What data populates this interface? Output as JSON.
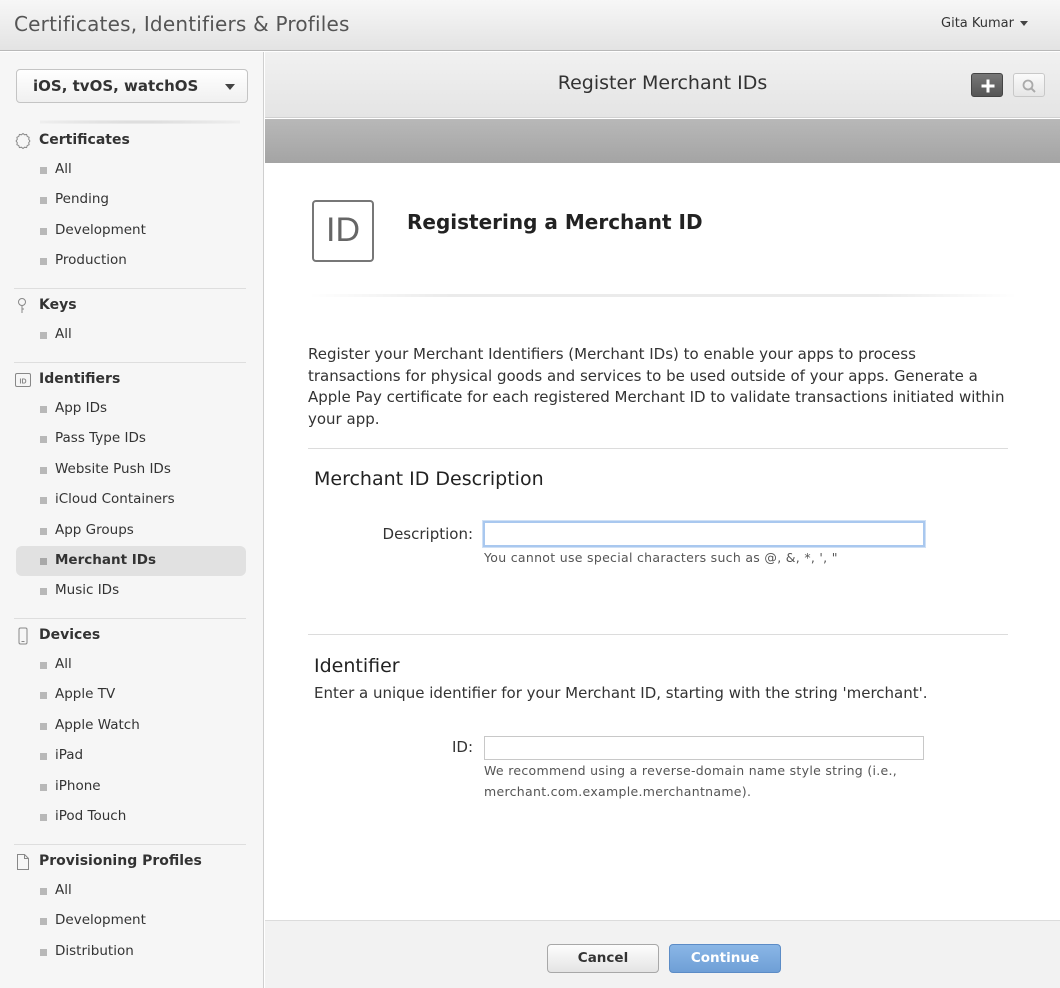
{
  "app_title": "Certificates, Identifiers & Profiles",
  "user": {
    "name": "Gita Kumar"
  },
  "sidebar": {
    "platform": "iOS, tvOS, watchOS",
    "sections": [
      {
        "title": "Certificates",
        "icon": "certificate-icon",
        "items": [
          "All",
          "Pending",
          "Development",
          "Production"
        ]
      },
      {
        "title": "Keys",
        "icon": "key-icon",
        "items": [
          "All"
        ]
      },
      {
        "title": "Identifiers",
        "icon": "id-icon",
        "items": [
          "App IDs",
          "Pass Type IDs",
          "Website Push IDs",
          "iCloud Containers",
          "App Groups",
          "Merchant IDs",
          "Music IDs"
        ]
      },
      {
        "title": "Devices",
        "icon": "device-icon",
        "items": [
          "All",
          "Apple TV",
          "Apple Watch",
          "iPad",
          "iPhone",
          "iPod Touch"
        ]
      },
      {
        "title": "Provisioning Profiles",
        "icon": "document-icon",
        "items": [
          "All",
          "Development",
          "Distribution"
        ]
      }
    ],
    "active_item": "Merchant IDs"
  },
  "header": {
    "title": "Register Merchant IDs"
  },
  "content": {
    "badge_text": "ID",
    "title": "Registering a Merchant ID",
    "intro": "Register your Merchant Identifiers (Merchant IDs) to enable your apps to process transactions for physical goods and services to be used outside of your apps. Generate a Apple Pay certificate for each registered Merchant ID to validate transactions initiated within your app.",
    "description_section": {
      "title": "Merchant ID Description",
      "label": "Description:",
      "value": "",
      "hint": "You cannot use special characters such as @, &, *, ', \""
    },
    "identifier_section": {
      "title": "Identifier",
      "subtitle": "Enter a unique identifier for your Merchant ID, starting with the string 'merchant'.",
      "label": "ID:",
      "value": "",
      "hint_line1": "We recommend using a reverse-domain name style string (i.e.,",
      "hint_line2": "merchant.com.example.merchantname)."
    }
  },
  "footer": {
    "cancel_label": "Cancel",
    "continue_label": "Continue"
  },
  "colors": {
    "accent": "#6f9fd6",
    "active_nav": "#e1e1e1"
  }
}
